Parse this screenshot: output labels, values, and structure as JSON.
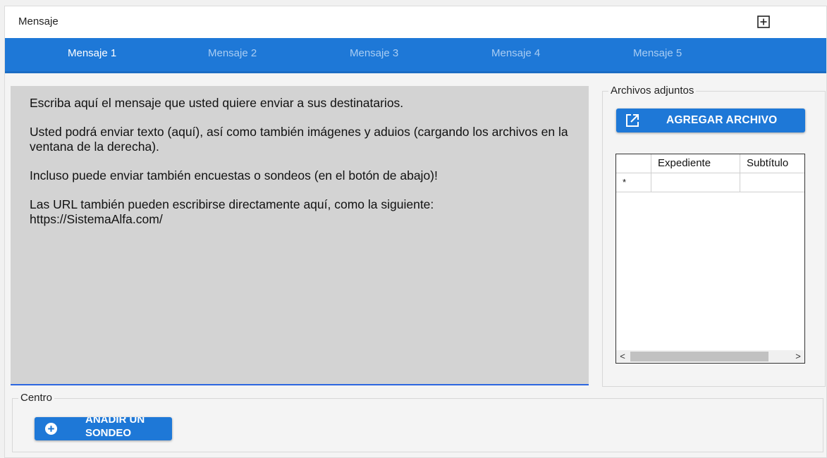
{
  "header": {
    "title": "Mensaje",
    "expand_icon": "plus-square-icon"
  },
  "tabs": [
    {
      "label": "Mensaje 1",
      "active": true
    },
    {
      "label": "Mensaje 2",
      "active": false
    },
    {
      "label": "Mensaje 3",
      "active": false
    },
    {
      "label": "Mensaje 4",
      "active": false
    },
    {
      "label": "Mensaje 5",
      "active": false
    }
  ],
  "editor": {
    "paragraphs": [
      "Escriba aquí el mensaje que usted quiere enviar a sus destinatarios.",
      "Usted podrá enviar texto (aquí), así como también imágenes y aduios (cargando los archivos en la ventana de la derecha).",
      "Incluso puede enviar también encuestas o sondeos (en el botón de abajo)!",
      "Las URL también pueden escribirse directamente aquí, como la siguiente: https://SistemaAlfa.com/"
    ]
  },
  "attachments": {
    "legend": "Archivos adjuntos",
    "add_button_label": "AGREGAR ARCHIVO",
    "add_button_icon": "external-link-icon",
    "columns": [
      "",
      "Expediente",
      "Subtítulo"
    ],
    "new_row_marker": "*",
    "scroll_left": "<",
    "scroll_right": ">"
  },
  "centro": {
    "legend": "Centro",
    "sondeo_button_label": "AÑADIR UN SONDEO",
    "sondeo_button_icon": "plus-circle-icon"
  },
  "colors": {
    "primary": "#1e78d7",
    "editor_bg": "#d3d3d3",
    "underline": "#2d67e0"
  }
}
